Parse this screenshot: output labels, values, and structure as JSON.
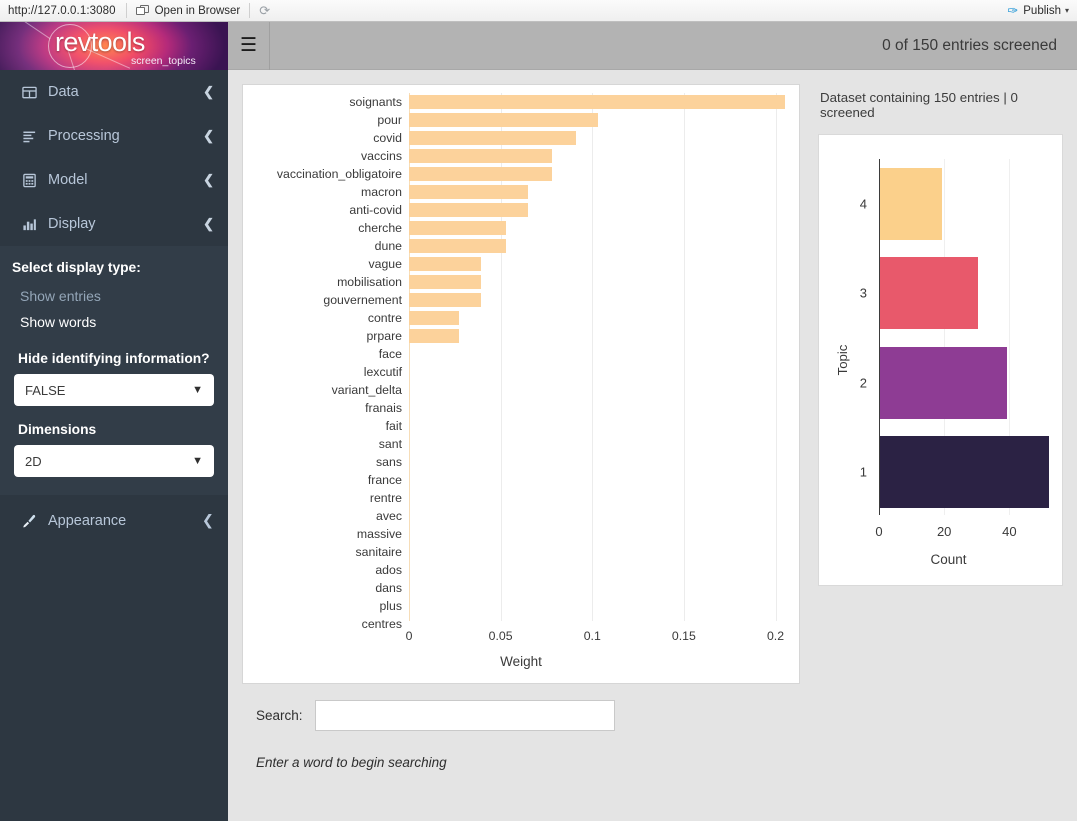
{
  "viewer_toolbar": {
    "url": "http://127.0.0.1:3080",
    "open_in_browser": "Open in Browser",
    "refresh_icon": "refresh-icon",
    "publish_label": "Publish",
    "publish_icon": "publish-icon",
    "caret": "▾"
  },
  "logo": {
    "wordmark": "revtools",
    "subtitle": "screen_topics"
  },
  "sidebar": {
    "menu": [
      {
        "label": "Data",
        "icon": "table-icon",
        "caret": "❮"
      },
      {
        "label": "Processing",
        "icon": "list-icon",
        "caret": "❮"
      },
      {
        "label": "Model",
        "icon": "calculator-icon",
        "caret": "❮"
      },
      {
        "label": "Display",
        "icon": "bar-chart-icon",
        "caret": "❮"
      }
    ],
    "display_options_title": "Select display type:",
    "display_links": [
      {
        "label": "Show entries",
        "active": false
      },
      {
        "label": "Show words",
        "active": true
      }
    ],
    "hide_info_label": "Hide identifying information?",
    "hide_info_value": "FALSE",
    "dimensions_label": "Dimensions",
    "dimensions_value": "2D",
    "appearance": {
      "label": "Appearance",
      "icon": "brush-icon",
      "caret": "❮"
    }
  },
  "topbar": {
    "hamburger_icon": "hamburger-icon",
    "screened_status": "0 of 150 entries screened"
  },
  "dataset_caption": "Dataset containing 150 entries | 0 screened",
  "search": {
    "label": "Search:",
    "value": "",
    "placeholder": "",
    "hint": "Enter a word to begin searching"
  },
  "chart_data": [
    {
      "type": "bar",
      "orientation": "horizontal",
      "title": "",
      "xlabel": "Weight",
      "ylabel": "",
      "xlim": [
        0,
        0.215
      ],
      "xticks": [
        0,
        0.05,
        0.1,
        0.15,
        0.2
      ],
      "xticklabels": [
        "0",
        "0.05",
        "0.1",
        "0.15",
        "0.2"
      ],
      "grid": true,
      "bar_color": "#fcd29b",
      "categories": [
        "soignants",
        "pour",
        "covid",
        "vaccins",
        "vaccination_obligatoire",
        "macron",
        "anti-covid",
        "cherche",
        "dune",
        "vague",
        "mobilisation",
        "gouvernement",
        "contre",
        "prpare",
        "face",
        "lexcutif",
        "variant_delta",
        "franais",
        "fait",
        "sant",
        "sans",
        "france",
        "rentre",
        "avec",
        "massive",
        "sanitaire",
        "ados",
        "dans",
        "plus",
        "centres"
      ],
      "values": [
        0.205,
        0.103,
        0.091,
        0.078,
        0.078,
        0.065,
        0.065,
        0.053,
        0.053,
        0.0395,
        0.0395,
        0.0395,
        0.0273,
        0.0273,
        0.0,
        0.0,
        0.0,
        0.0,
        0.0,
        0.0,
        0.0,
        0.0,
        0.0,
        0.0,
        0.0,
        0.0,
        0.0,
        0.0,
        0.0,
        0.0
      ]
    },
    {
      "type": "bar",
      "orientation": "horizontal",
      "title": "",
      "xlabel": "Count",
      "ylabel": "Topic",
      "xlim": [
        0,
        54
      ],
      "xticks": [
        0,
        20,
        40
      ],
      "xticklabels": [
        "0",
        "20",
        "40"
      ],
      "grid": true,
      "categories": [
        "1",
        "2",
        "3",
        "4"
      ],
      "values": [
        52,
        39,
        30,
        19
      ],
      "colors": [
        "#2b2244",
        "#8e3c94",
        "#e8596b",
        "#fbd08b"
      ]
    }
  ]
}
